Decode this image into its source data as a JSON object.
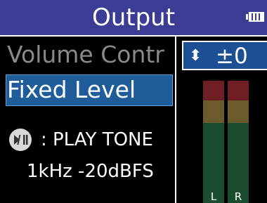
{
  "header": {
    "title": "Output"
  },
  "menu": {
    "items": [
      {
        "label": "Volume Contr"
      },
      {
        "label": "Fixed Level"
      }
    ]
  },
  "setting": {
    "value": "±0"
  },
  "tone": {
    "label": ": PLAY TONE",
    "spec": "1kHz -20dBFS"
  },
  "meters": {
    "left_label": "L",
    "right_label": "R"
  },
  "colors": {
    "titlebar": "#3b3c93",
    "selection": "#1e5c9a",
    "meter_red": "#6f1f24",
    "meter_yellow": "#6c5b2a",
    "meter_green": "#1a4d2f"
  }
}
